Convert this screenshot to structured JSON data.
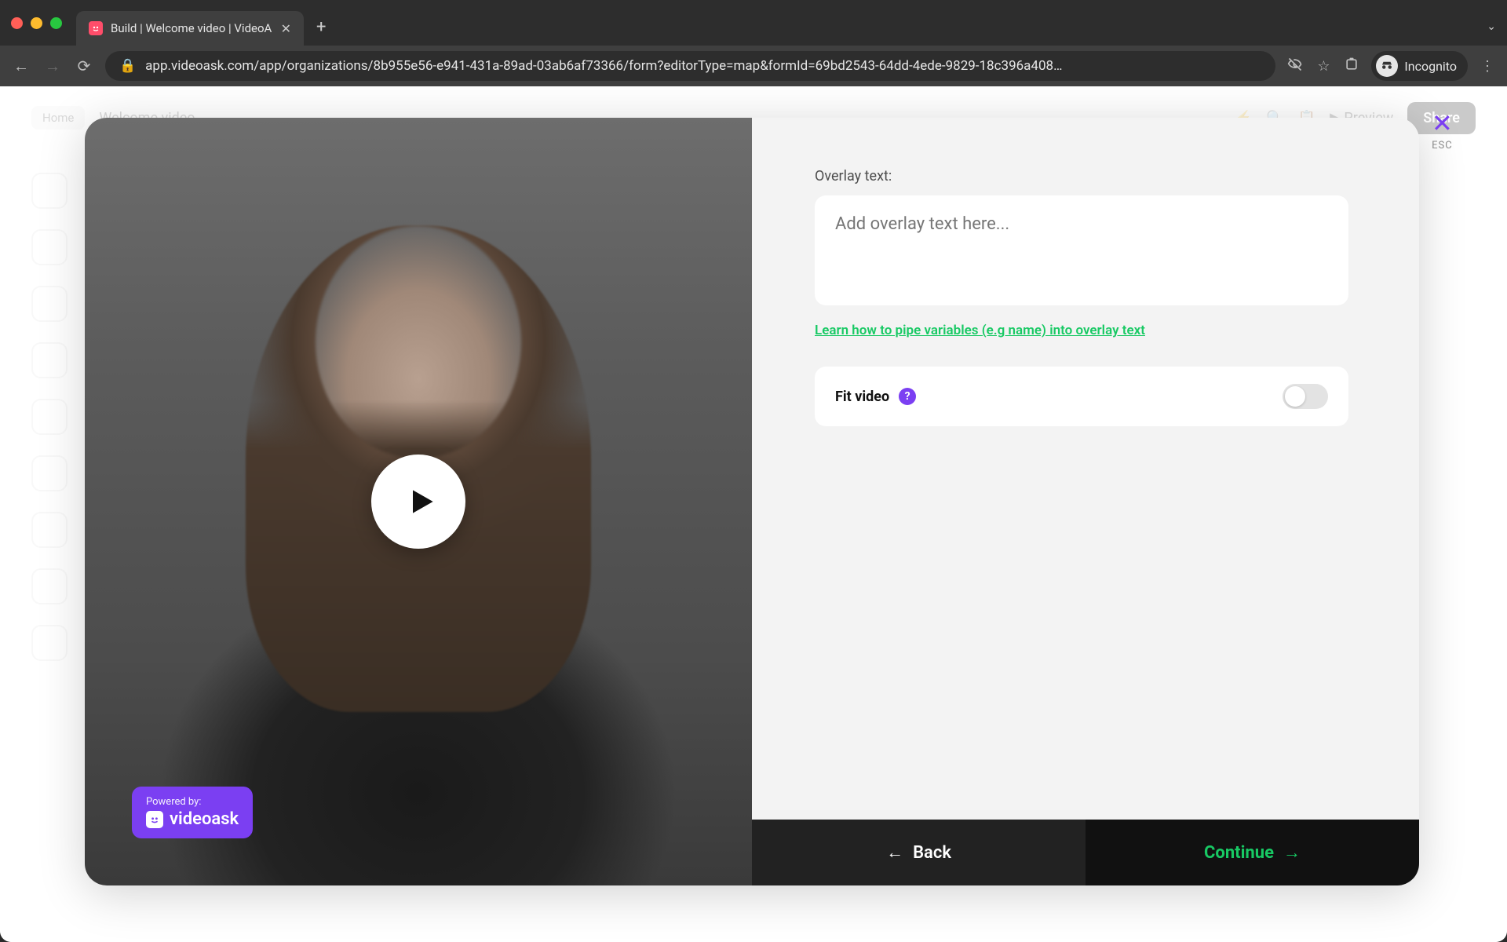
{
  "browser": {
    "tab_title": "Build | Welcome video | VideoA",
    "url": "app.videoask.com/app/organizations/8b955e56-e941-431a-89ad-03ab6af73366/form?editorType=map&formId=69bd2543-64dd-4ede-9829-18c396a408…",
    "incognito_label": "Incognito"
  },
  "background": {
    "breadcrumb_root": "Home",
    "breadcrumb_current": "Welcome video",
    "preview": "Preview",
    "share": "Share"
  },
  "close": {
    "esc": "ESC"
  },
  "powered": {
    "label": "Powered by:",
    "brand": "videoask"
  },
  "form": {
    "overlay_label": "Overlay text:",
    "overlay_placeholder": "Add overlay text here...",
    "help_link": "Learn how to pipe variables (e.g name) into overlay text",
    "fit_video_label": "Fit video",
    "help_badge": "?"
  },
  "footer": {
    "back": "Back",
    "continue": "Continue"
  }
}
